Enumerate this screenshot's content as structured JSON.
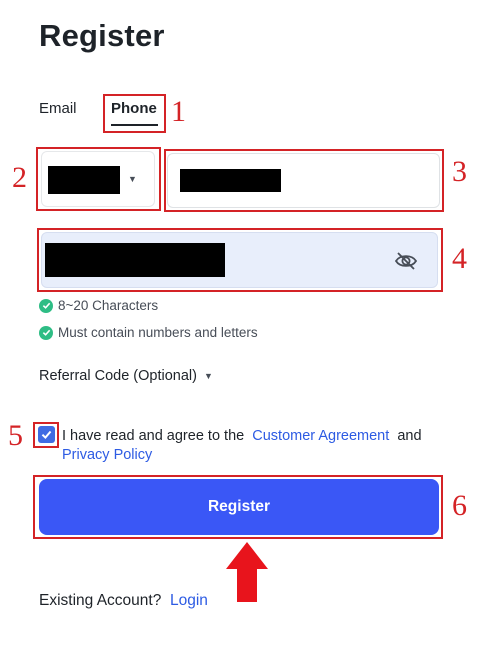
{
  "page": {
    "title": "Register"
  },
  "tabs": [
    {
      "label": "Email",
      "active": false
    },
    {
      "label": "Phone",
      "active": true
    }
  ],
  "form": {
    "country_code": {
      "value": "",
      "redacted": true,
      "icon": "caret-down-icon"
    },
    "phone_number": {
      "value": "",
      "redacted": true
    },
    "password": {
      "value": "",
      "redacted": true,
      "icon": "eye-slash-icon"
    },
    "rules": [
      {
        "text": "8~20 Characters",
        "satisfied": true
      },
      {
        "text": "Must contain numbers and letters",
        "satisfied": true
      }
    ],
    "referral": {
      "label": "Referral Code (Optional)"
    },
    "agreement": {
      "checked": true,
      "prefix": "I have read and agree to the",
      "link1": "Customer Agreement",
      "connector": "and",
      "link2": "Privacy Policy"
    },
    "submit_label": "Register"
  },
  "footer": {
    "prompt": "Existing Account?",
    "login_link": "Login"
  },
  "annotations": [
    "1",
    "2",
    "3",
    "4",
    "5",
    "6"
  ],
  "colors": {
    "primary": "#3a57f6",
    "link": "#2d5be3",
    "success": "#2ebd85",
    "annotation": "#d42326"
  }
}
